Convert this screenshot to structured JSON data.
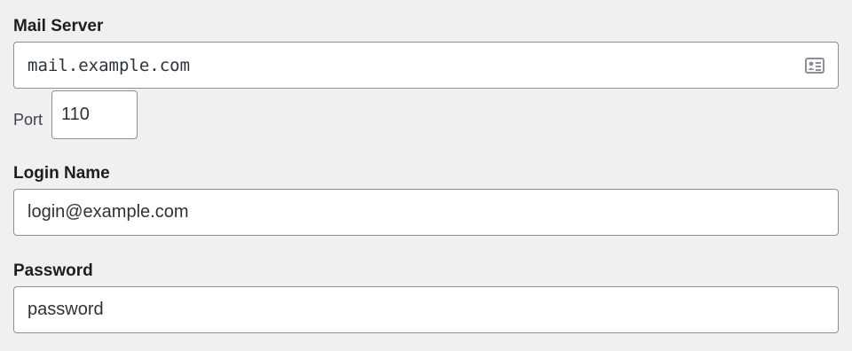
{
  "mail_server": {
    "label": "Mail Server",
    "value": "mail.example.com",
    "icon": "contact-card-icon"
  },
  "port": {
    "label": "Port",
    "value": "110"
  },
  "login_name": {
    "label": "Login Name",
    "value": "login@example.com"
  },
  "password": {
    "label": "Password",
    "value": "password"
  },
  "colors": {
    "background": "#f0f0f0",
    "field_border": "#8c8f94",
    "icon": "#8c8f94"
  }
}
